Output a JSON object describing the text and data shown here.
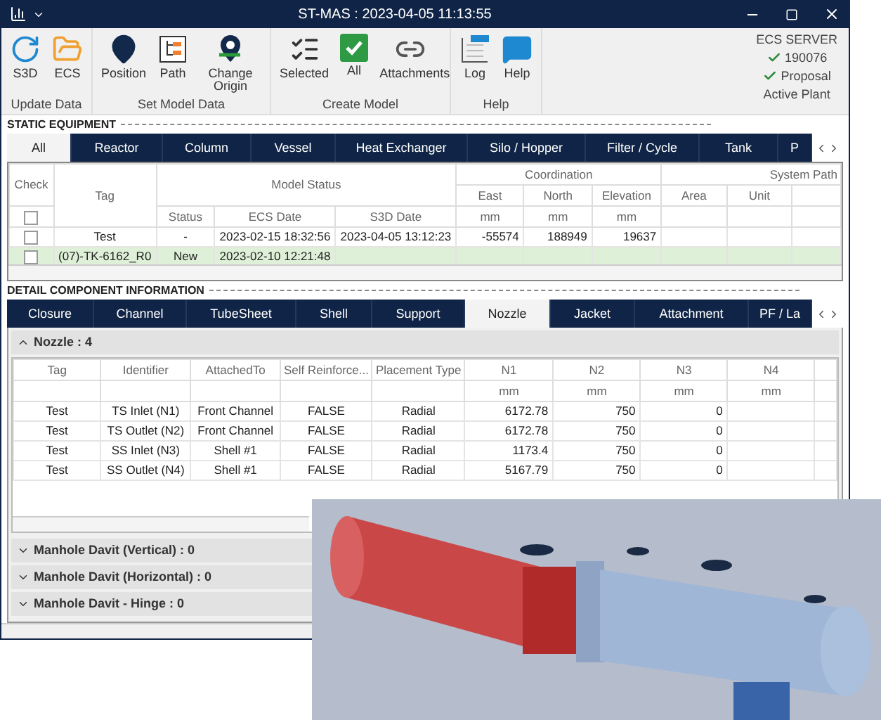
{
  "window": {
    "title": "ST-MAS : 2023-04-05 11:13:55"
  },
  "ribbon": {
    "groups": [
      {
        "label": "Update Data",
        "buttons": [
          {
            "label": "S3D",
            "kind": "refresh"
          },
          {
            "label": "ECS",
            "kind": "folder"
          }
        ]
      },
      {
        "label": "Set Model Data",
        "buttons": [
          {
            "label": "Position",
            "kind": "pin"
          },
          {
            "label": "Path",
            "kind": "path"
          },
          {
            "label": "Change Origin",
            "kind": "origin"
          }
        ]
      },
      {
        "label": "Create Model",
        "buttons": [
          {
            "label": "Selected",
            "kind": "checklist"
          },
          {
            "label": "All",
            "kind": "check"
          },
          {
            "label": "Attachments",
            "kind": "link"
          }
        ]
      },
      {
        "label": "Help",
        "buttons": [
          {
            "label": "Log",
            "kind": "log"
          },
          {
            "label": "Help",
            "kind": "help"
          }
        ]
      }
    ]
  },
  "server_panel": {
    "title": "ECS SERVER",
    "items": [
      {
        "label": "190076",
        "checked": true
      },
      {
        "label": "Proposal",
        "checked": true
      }
    ],
    "caption": "Active Plant"
  },
  "static_equipment": {
    "heading": "STATIC EQUIPMENT",
    "tabs": [
      {
        "label": "All",
        "selected": true
      },
      {
        "label": "Reactor",
        "selected": false
      },
      {
        "label": "Column",
        "selected": false
      },
      {
        "label": "Vessel",
        "selected": false
      },
      {
        "label": "Heat Exchanger",
        "selected": false
      },
      {
        "label": "Silo / Hopper",
        "selected": false
      },
      {
        "label": "Filter / Cycle",
        "selected": false
      },
      {
        "label": "Tank",
        "selected": false
      },
      {
        "label": "P",
        "selected": false
      }
    ],
    "headers": {
      "check": "Check",
      "tag": "Tag",
      "model_status": "Model Status",
      "status": "Status",
      "ecs_date": "ECS Date",
      "s3d_date": "S3D Date",
      "coordination": "Coordination",
      "east": "East",
      "north": "North",
      "elevation": "Elevation",
      "system_path": "System Path",
      "area": "Area",
      "unit": "Unit",
      "east_unit": "mm",
      "north_unit": "mm",
      "elevation_unit": "mm"
    },
    "header_checked": false,
    "rows": [
      {
        "checked": false,
        "selected": false,
        "tag": "Test",
        "status": "-",
        "ecs_date": "2023-02-15 18:32:56",
        "s3d_date": "2023-04-05 13:12:23",
        "east": "-55574",
        "north": "188949",
        "elevation": "19637"
      },
      {
        "checked": false,
        "selected": true,
        "tag": "(07)-TK-6162_R0",
        "status": "New",
        "ecs_date": "2023-02-10 12:21:48",
        "s3d_date": "",
        "east": "",
        "north": "",
        "elevation": ""
      }
    ]
  },
  "detail": {
    "heading": "DETAIL COMPONENT INFORMATION",
    "tabs": [
      {
        "label": "Closure",
        "selected": false
      },
      {
        "label": "Channel",
        "selected": false
      },
      {
        "label": "TubeSheet",
        "selected": false
      },
      {
        "label": "Shell",
        "selected": false
      },
      {
        "label": "Support",
        "selected": false
      },
      {
        "label": "Nozzle",
        "selected": true
      },
      {
        "label": "Jacket",
        "selected": false
      },
      {
        "label": "Attachment",
        "selected": false
      },
      {
        "label": "PF / La",
        "selected": false
      }
    ],
    "sections": [
      {
        "title": "Nozzle : 4",
        "expanded": true,
        "columns": [
          {
            "label": "Tag"
          },
          {
            "label": "Identifier"
          },
          {
            "label": "AttachedTo"
          },
          {
            "label": "Self Reinforce..."
          },
          {
            "label": "Placement Type"
          },
          {
            "label": "N1",
            "unit": "mm"
          },
          {
            "label": "N2",
            "unit": "mm"
          },
          {
            "label": "N3",
            "unit": "mm"
          },
          {
            "label": "N4",
            "unit": "mm"
          }
        ],
        "rows": [
          [
            "Test",
            "TS Inlet (N1)",
            "Front Channel",
            "FALSE",
            "Radial",
            "6172.78",
            "750",
            "0",
            ""
          ],
          [
            "Test",
            "TS Outlet (N2)",
            "Front Channel",
            "FALSE",
            "Radial",
            "6172.78",
            "750",
            "0",
            ""
          ],
          [
            "Test",
            "SS Inlet (N3)",
            "Shell #1",
            "FALSE",
            "Radial",
            "1173.4",
            "750",
            "0",
            ""
          ],
          [
            "Test",
            "SS Outlet (N4)",
            "Shell #1",
            "FALSE",
            "Radial",
            "5167.79",
            "750",
            "0",
            ""
          ]
        ]
      },
      {
        "title": "Manhole Davit (Vertical) : 0",
        "expanded": false
      },
      {
        "title": "Manhole Davit (Horizontal) : 0",
        "expanded": false
      },
      {
        "title": "Manhole Davit - Hinge : 0",
        "expanded": false
      }
    ]
  }
}
